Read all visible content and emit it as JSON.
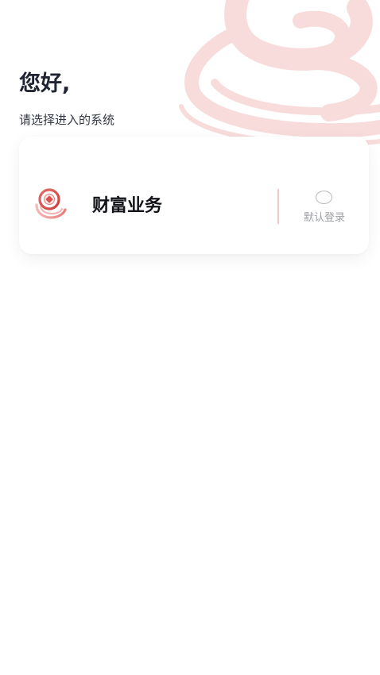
{
  "header": {
    "greeting": "您好,",
    "subtitle": "请选择进入的系统"
  },
  "systems": [
    {
      "name": "财富业务",
      "icon": "wealth-coin-icon",
      "default_login_label": "默认登录",
      "default_selected": false
    }
  ],
  "colors": {
    "brand_red": "#e05a56",
    "watermark_pink": "#f7dada",
    "divider": "#efc9c9"
  },
  "decor": {
    "background_logo": "brand-logo-watermark"
  }
}
